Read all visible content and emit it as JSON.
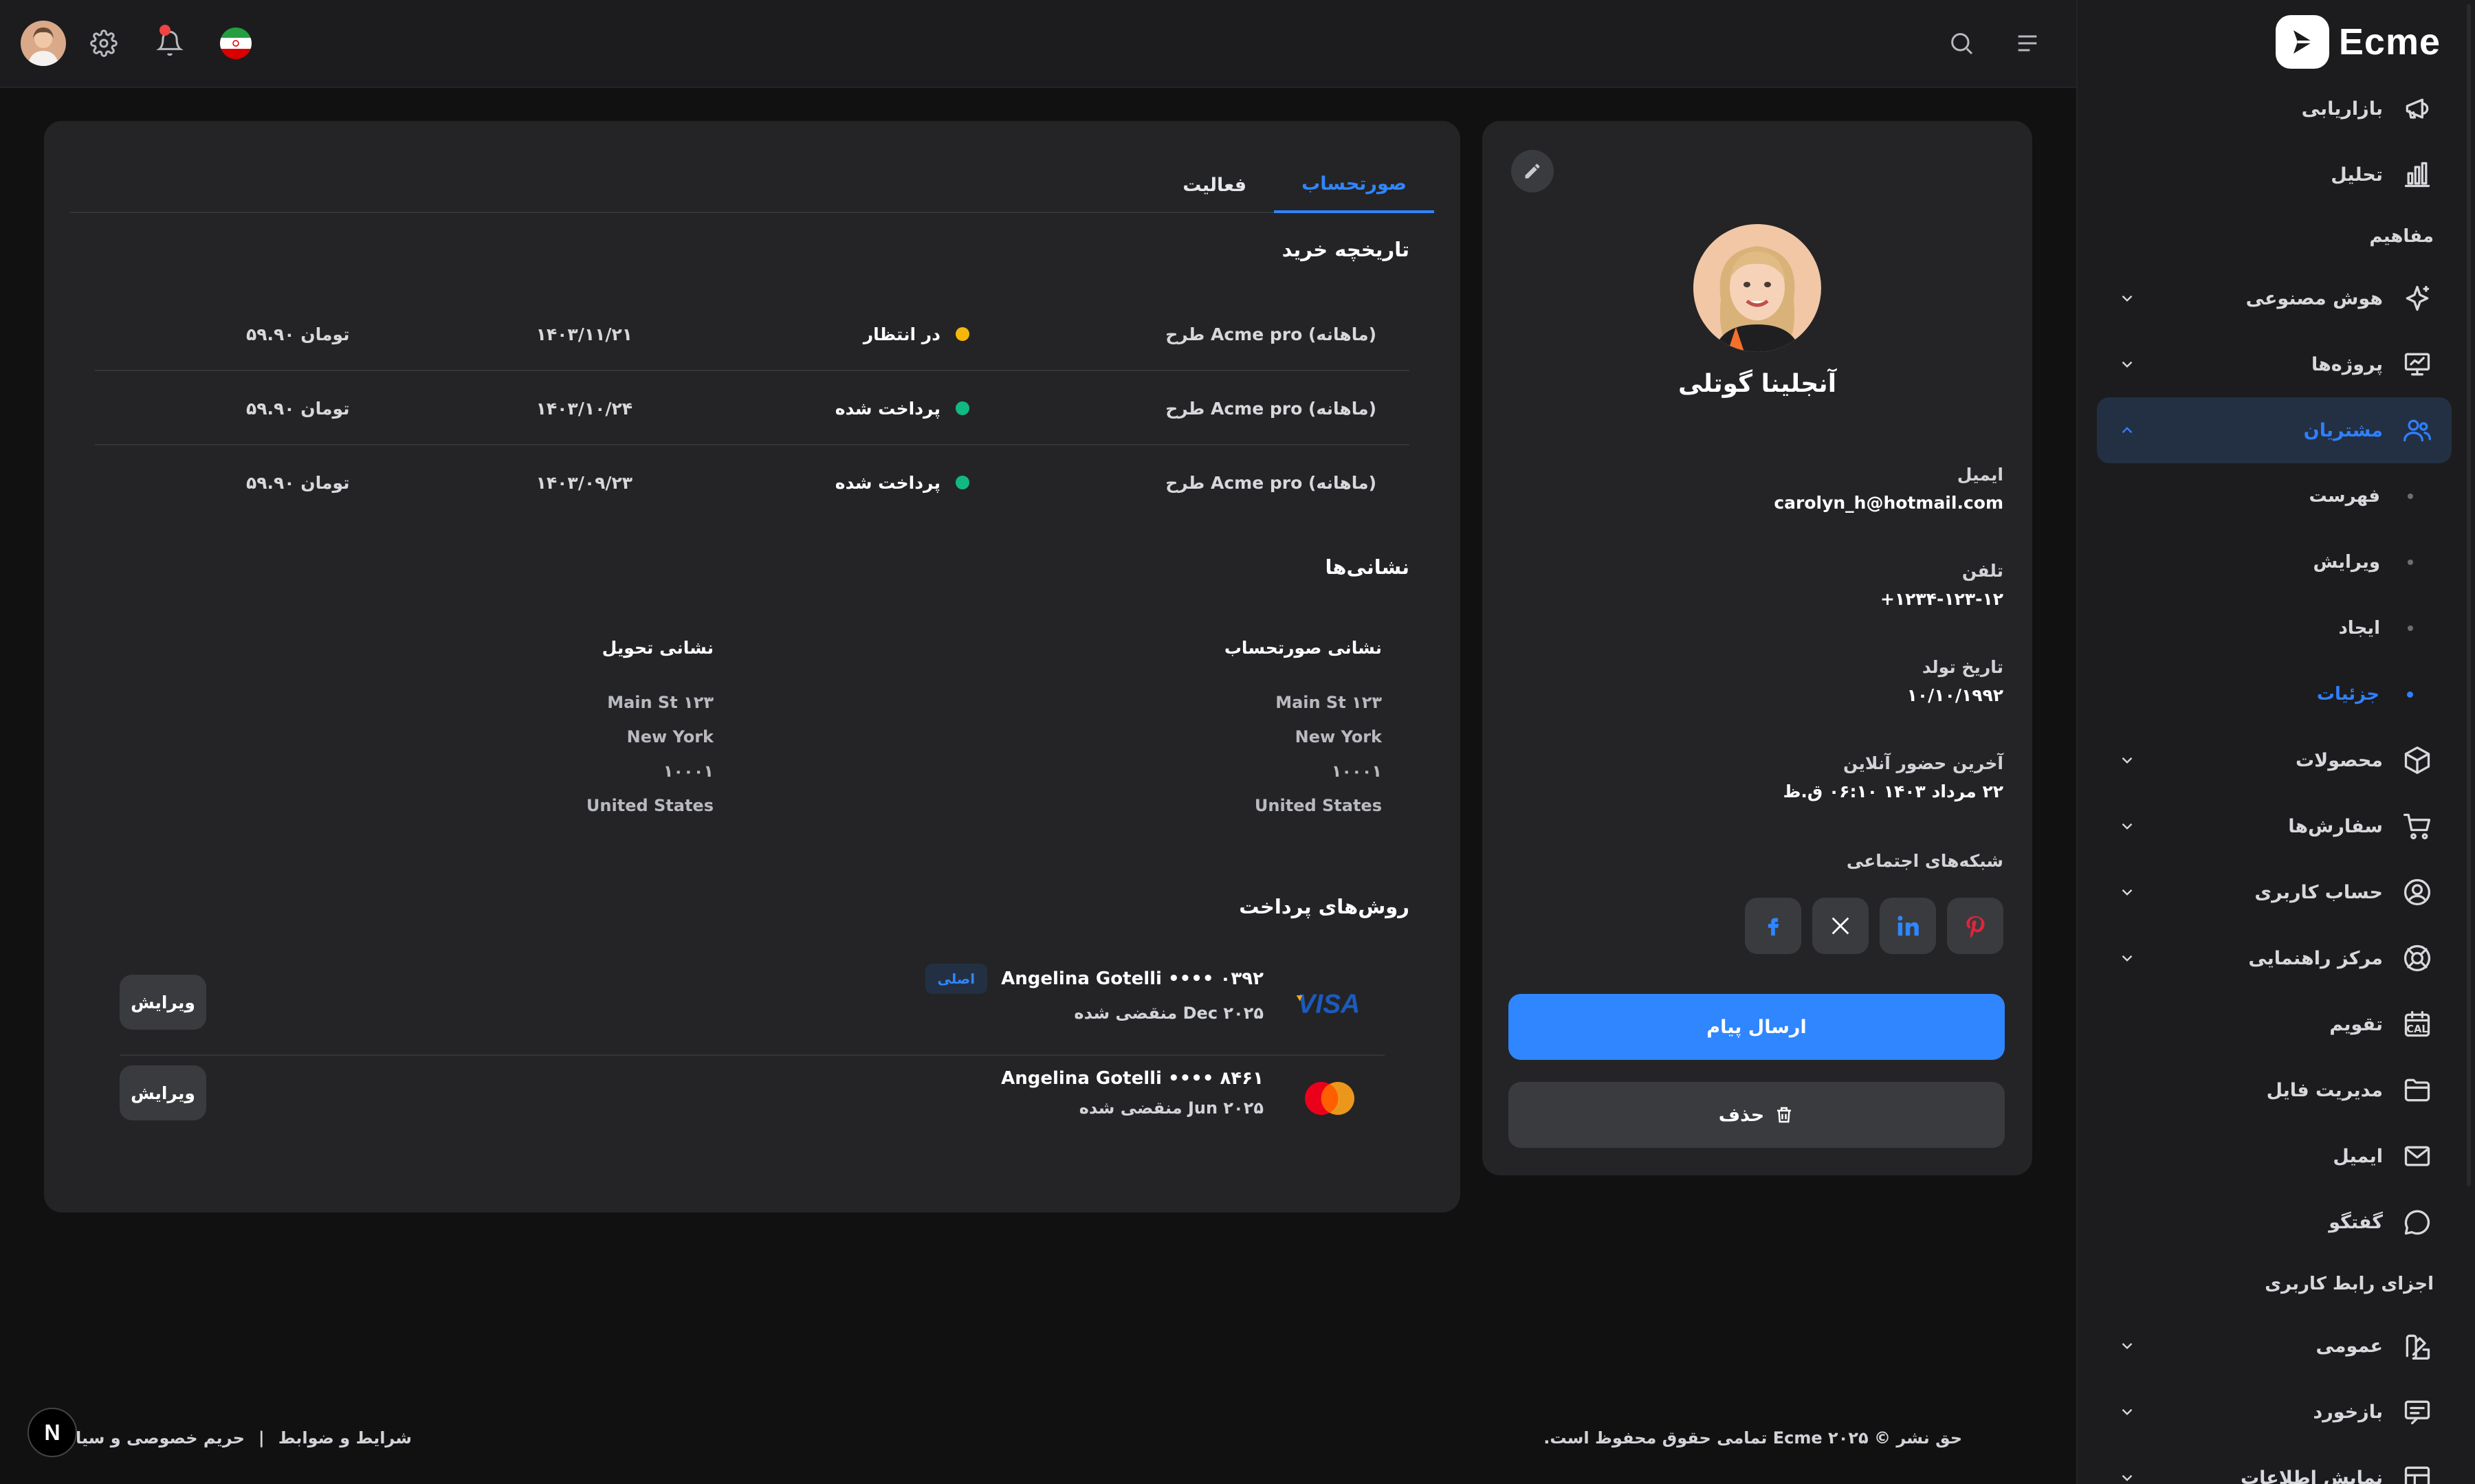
{
  "brand": {
    "name": "Ecme"
  },
  "sidebar": {
    "items": [
      {
        "type": "item",
        "label": "بازاریابی",
        "icon": "megaphone-icon",
        "chevron": false
      },
      {
        "type": "item",
        "label": "تحلیل",
        "icon": "bar-chart-icon",
        "chevron": false
      },
      {
        "type": "heading",
        "label": "مفاهیم"
      },
      {
        "type": "item",
        "label": "هوش مصنوعی",
        "icon": "sparkle-icon",
        "chevron": true
      },
      {
        "type": "item",
        "label": "پروژه‌ها",
        "icon": "presentation-icon",
        "chevron": true
      },
      {
        "type": "item",
        "label": "مشتریان",
        "icon": "users-icon",
        "chevron": true,
        "active": true,
        "expanded": true
      },
      {
        "type": "sub",
        "label": "فهرست"
      },
      {
        "type": "sub",
        "label": "ویرایش"
      },
      {
        "type": "sub",
        "label": "ایجاد"
      },
      {
        "type": "sub",
        "label": "جزئیات",
        "active": true
      },
      {
        "type": "item",
        "label": "محصولات",
        "icon": "box-icon",
        "chevron": true
      },
      {
        "type": "item",
        "label": "سفارش‌ها",
        "icon": "cart-icon",
        "chevron": true
      },
      {
        "type": "item",
        "label": "حساب کاربری",
        "icon": "user-circle-icon",
        "chevron": true
      },
      {
        "type": "item",
        "label": "مرکز راهنمایی",
        "icon": "lifebuoy-icon",
        "chevron": true
      },
      {
        "type": "item",
        "label": "تقویم",
        "icon": "calendar-icon",
        "chevron": false
      },
      {
        "type": "item",
        "label": "مدیریت فایل",
        "icon": "folder-icon",
        "chevron": false
      },
      {
        "type": "item",
        "label": "ایمیل",
        "icon": "mail-icon",
        "chevron": false
      },
      {
        "type": "item",
        "label": "گفتگو",
        "icon": "chat-icon",
        "chevron": false
      },
      {
        "type": "heading",
        "label": "اجزای رابط کاربری"
      },
      {
        "type": "item",
        "label": "عمومی",
        "icon": "swatch-icon",
        "chevron": true
      },
      {
        "type": "item",
        "label": "بازخورد",
        "icon": "message-square-icon",
        "chevron": true
      },
      {
        "type": "item",
        "label": "نمایش اطلاعات",
        "icon": "table-icon",
        "chevron": true
      }
    ],
    "calendar_day": "12"
  },
  "topbar": {
    "icons": [
      "avatar",
      "gear-icon",
      "bell-icon",
      "iran-flag-icon",
      "search-icon",
      "menu-icon"
    ]
  },
  "profile": {
    "name": "آنجلینا گوتلی",
    "email_label": "ایمیل",
    "email": "carolyn_h@hotmail.com",
    "phone_label": "تلفن",
    "phone": "+۱۲۳۴-۱۲۳-۱۲",
    "birthday_label": "تاریخ تولد",
    "birthday": "۱۰/۱۰/۱۹۹۲",
    "last_online_label": "آخرین حضور آنلاین",
    "last_online": "۲۲ مرداد ۱۴۰۳ ۰۶:۱۰ ق.ظ",
    "social_label": "شبکه‌های اجتماعی",
    "social": [
      "facebook-icon",
      "x-icon",
      "linkedin-icon",
      "pinterest-icon"
    ],
    "send_message": "ارسال پیام",
    "delete": "حذف"
  },
  "tabs": [
    {
      "label": "صورتحساب",
      "active": true
    },
    {
      "label": "فعالیت",
      "active": false
    }
  ],
  "purchase_history": {
    "title": "تاریخچه خرید",
    "rows": [
      {
        "plan": "طرح Acme pro (ماهانه)",
        "status": "در انتظار",
        "status_color": "#f5b70a",
        "date": "۱۴۰۳/۱۱/۲۱",
        "amount": "۵۹.۹۰ تومان"
      },
      {
        "plan": "طرح Acme pro (ماهانه)",
        "status": "پرداخت شده",
        "status_color": "#10b981",
        "date": "۱۴۰۳/۱۰/۲۴",
        "amount": "۵۹.۹۰ تومان"
      },
      {
        "plan": "طرح Acme pro (ماهانه)",
        "status": "پرداخت شده",
        "status_color": "#10b981",
        "date": "۱۴۰۳/۰۹/۲۳",
        "amount": "۵۹.۹۰ تومان"
      }
    ]
  },
  "addresses": {
    "title": "نشانی‌ها",
    "billing": {
      "title": "نشانی صورتحساب",
      "lines": [
        "Main St ۱۲۳",
        "New York",
        "۱۰۰۰۱",
        "United States"
      ]
    },
    "shipping": {
      "title": "نشانی تحویل",
      "lines": [
        "Main St ۱۲۳",
        "New York",
        "۱۰۰۰۱",
        "United States"
      ]
    }
  },
  "payment_methods": {
    "title": "روش‌های پرداخت",
    "cards": [
      {
        "brand": "visa",
        "line1": "Angelina Gotelli •••• ۰۳۹۲",
        "badge": "اصلی",
        "expiry": "منقضی شده Dec ۲۰۲۵",
        "edit": "ویرایش"
      },
      {
        "brand": "mastercard",
        "line1": "Angelina Gotelli •••• ۸۴۶۱",
        "badge": "",
        "expiry": "منقضی شده Jun ۲۰۲۵",
        "edit": "ویرایش"
      }
    ]
  },
  "footer": {
    "copyright": "حق نشر © ۲۰۲۵ Ecme تمامی حقوق محفوظ است.",
    "terms": "شرایط و ضوابط",
    "separator": "|",
    "privacy": "حریم خصوصی و سیا"
  },
  "next_badge": "N",
  "colors": {
    "accent": "#2f86ff",
    "pending": "#f5b70a",
    "paid": "#10b981",
    "danger_dot": "#ef4444"
  }
}
